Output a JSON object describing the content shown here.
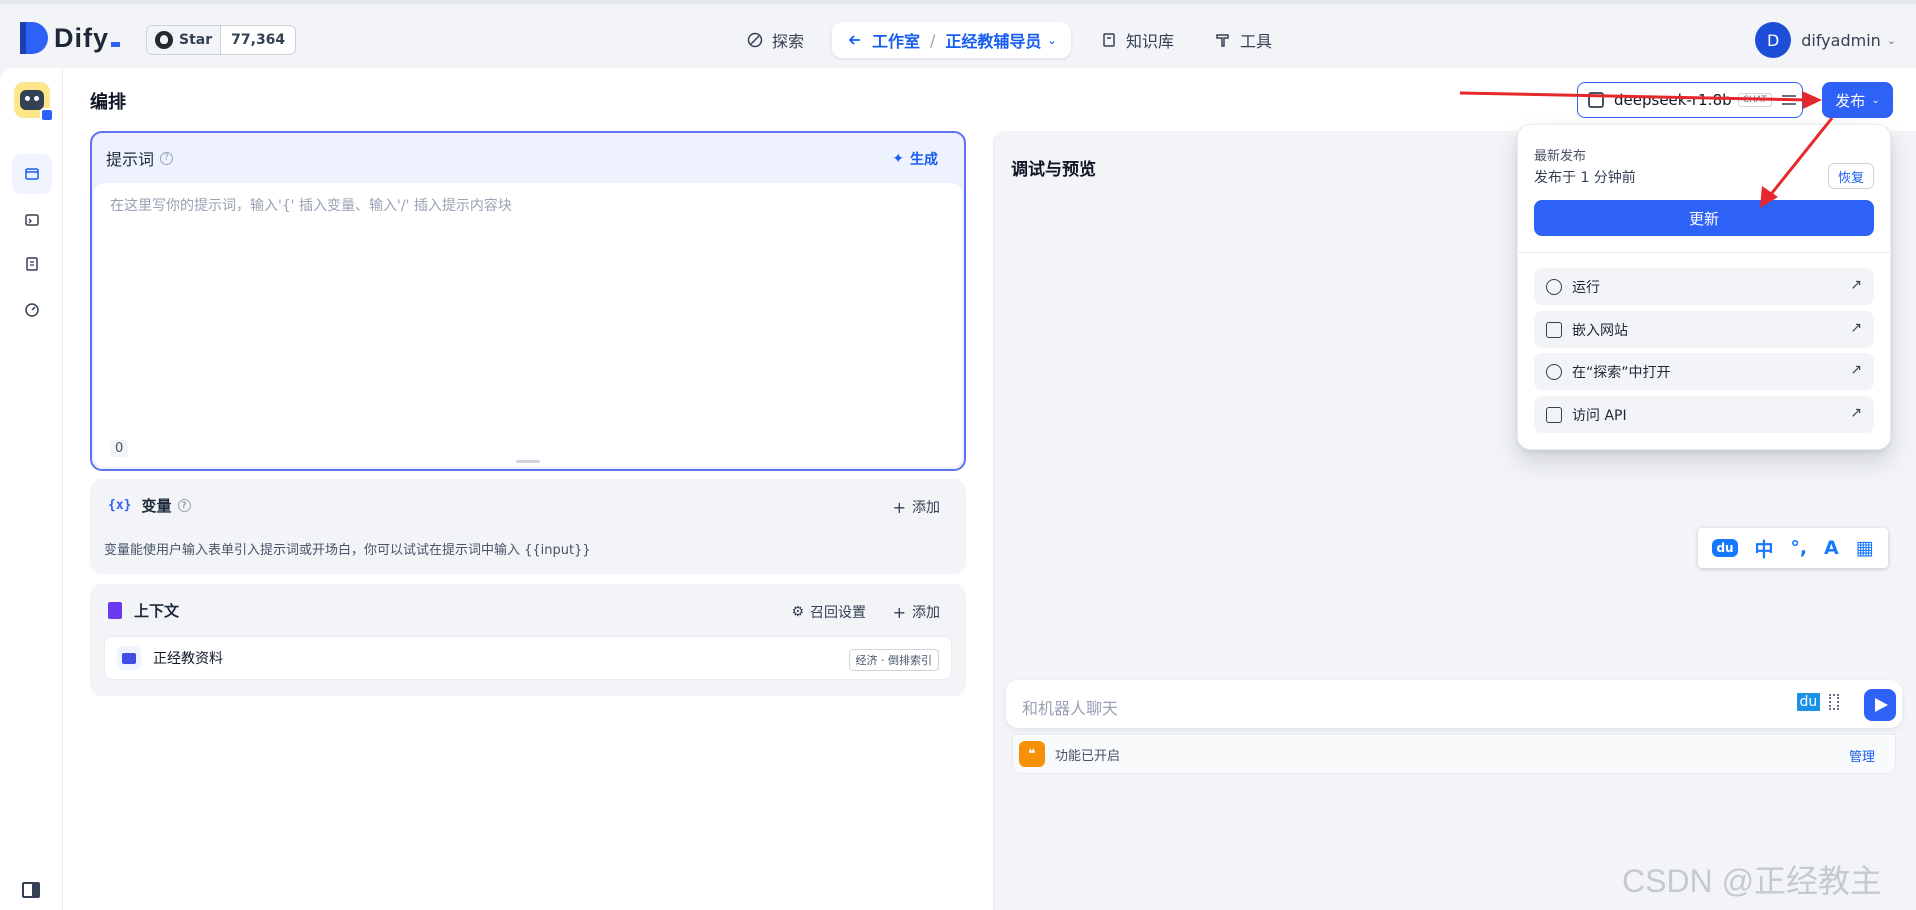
{
  "brand": {
    "name": "Dify"
  },
  "github": {
    "label": "Star",
    "count": "77,364"
  },
  "nav": {
    "explore": "探索",
    "studio": "工作室",
    "app": "正经教辅导员",
    "knowledge": "知识库",
    "tools": "工具"
  },
  "user": {
    "initial": "D",
    "name": "difyadmin"
  },
  "page": {
    "title": "编排"
  },
  "prompt": {
    "title": "提示词",
    "generate": "生成",
    "placeholder": "在这里写你的提示词，输入'{' 插入变量、输入'/' 插入提示内容块",
    "count": "0"
  },
  "variables": {
    "icon": "{x}",
    "title": "变量",
    "add": "添加",
    "desc": "变量能使用户输入表单引入提示词或开场白，你可以试试在提示词中输入 {{input}}"
  },
  "context": {
    "title": "上下文",
    "recall": "召回设置",
    "add": "添加",
    "item_name": "正经教资料",
    "item_tag": "经济 · 倒排索引"
  },
  "debug": {
    "title": "调试与预览",
    "chat_placeholder": "和机器人聊天",
    "feature": "功能已开启",
    "manage": "管理"
  },
  "model": {
    "name": "deepseek-r1:8b",
    "tag": "CHAT"
  },
  "publish": {
    "label": "发布"
  },
  "dropdown": {
    "latest": "最新发布",
    "time": "发布于 1 分钟前",
    "restore": "恢复",
    "update": "更新",
    "items": [
      {
        "label": "运行",
        "icon": "play-circle-icon"
      },
      {
        "label": "嵌入网站",
        "icon": "embed-icon"
      },
      {
        "label": "在“探索”中打开",
        "icon": "explore-icon"
      },
      {
        "label": "访问 API",
        "icon": "document-icon"
      }
    ]
  },
  "ime": {
    "du": "du",
    "zh": "中",
    "punct": "°,",
    "skin": "A",
    "grid": "▦"
  },
  "watermark": "CSDN @正经教主",
  "colors": {
    "accent": "#2e62f6",
    "annotation": "#e5282b"
  }
}
